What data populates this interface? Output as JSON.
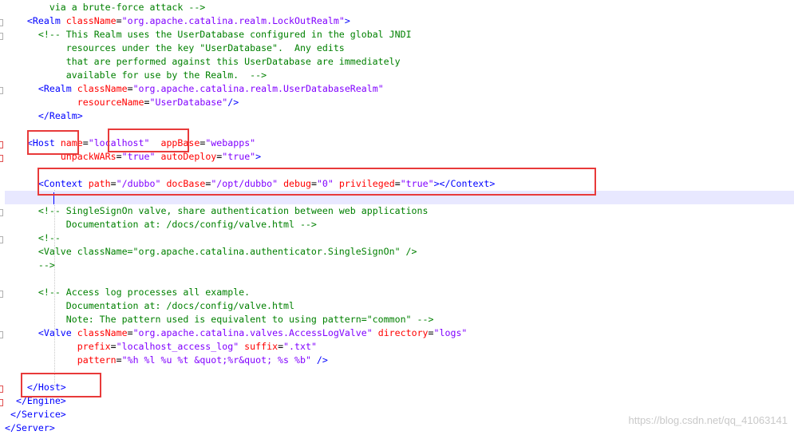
{
  "colors": {
    "tag": "#0000ff",
    "attr": "#ff0000",
    "value": "#8000ff",
    "comment": "#008000",
    "highlight_box": "#e83a3a",
    "current_line": "#e8e8ff"
  },
  "watermark": "https://blog.csdn.net/qq_41063141",
  "lines": [
    [
      [
        "cmt",
        "        via a brute-force attack -->"
      ]
    ],
    [
      [
        "txt",
        "    "
      ],
      [
        "tag",
        "<Realm "
      ],
      [
        "attr",
        "className"
      ],
      [
        "txt",
        "="
      ],
      [
        "val",
        "\"org.apache.catalina.realm.LockOutRealm\""
      ],
      [
        "tag",
        ">"
      ]
    ],
    [
      [
        "txt",
        "      "
      ],
      [
        "cmt",
        "<!-- This Realm uses the UserDatabase configured in the global JNDI"
      ]
    ],
    [
      [
        "cmt",
        "           resources under the key \"UserDatabase\".  Any edits"
      ]
    ],
    [
      [
        "cmt",
        "           that are performed against this UserDatabase are immediately"
      ]
    ],
    [
      [
        "cmt",
        "           available for use by the Realm.  -->"
      ]
    ],
    [
      [
        "txt",
        "      "
      ],
      [
        "tag",
        "<Realm "
      ],
      [
        "attr",
        "className"
      ],
      [
        "txt",
        "="
      ],
      [
        "val",
        "\"org.apache.catalina.realm.UserDatabaseRealm\""
      ]
    ],
    [
      [
        "txt",
        "             "
      ],
      [
        "attr",
        "resourceName"
      ],
      [
        "txt",
        "="
      ],
      [
        "val",
        "\"UserDatabase\""
      ],
      [
        "tag",
        "/>"
      ]
    ],
    [
      [
        "txt",
        "      "
      ],
      [
        "tag",
        "</Realm>"
      ]
    ],
    [
      [
        "txt",
        ""
      ]
    ],
    [
      [
        "txt",
        "    "
      ],
      [
        "tag",
        "<Host "
      ],
      [
        "attr",
        "name"
      ],
      [
        "txt",
        "="
      ],
      [
        "val",
        "\"localhost\""
      ],
      [
        "txt",
        "  "
      ],
      [
        "attr",
        "appBase"
      ],
      [
        "txt",
        "="
      ],
      [
        "val",
        "\"webapps\""
      ]
    ],
    [
      [
        "txt",
        "          "
      ],
      [
        "attr",
        "unpackWARs"
      ],
      [
        "txt",
        "="
      ],
      [
        "val",
        "\"true\""
      ],
      [
        "txt",
        " "
      ],
      [
        "attr",
        "autoDeploy"
      ],
      [
        "txt",
        "="
      ],
      [
        "val",
        "\"true\""
      ],
      [
        "tag",
        ">"
      ]
    ],
    [
      [
        "txt",
        ""
      ]
    ],
    [
      [
        "txt",
        "      "
      ],
      [
        "tag",
        "<Context "
      ],
      [
        "attr",
        "path"
      ],
      [
        "txt",
        "="
      ],
      [
        "val",
        "\"/dubbo\""
      ],
      [
        "txt",
        " "
      ],
      [
        "attr",
        "docBase"
      ],
      [
        "txt",
        "="
      ],
      [
        "val",
        "\"/opt/dubbo\""
      ],
      [
        "txt",
        " "
      ],
      [
        "attr",
        "debug"
      ],
      [
        "txt",
        "="
      ],
      [
        "val",
        "\"0\""
      ],
      [
        "txt",
        " "
      ],
      [
        "attr",
        "privileged"
      ],
      [
        "txt",
        "="
      ],
      [
        "val",
        "\"true\""
      ],
      [
        "tag",
        "></Context>"
      ]
    ],
    [
      [
        "txt",
        ""
      ]
    ],
    [
      [
        "txt",
        "      "
      ],
      [
        "cmt",
        "<!-- SingleSignOn valve, share authentication between web applications"
      ]
    ],
    [
      [
        "cmt",
        "           Documentation at: /docs/config/valve.html -->"
      ]
    ],
    [
      [
        "txt",
        "      "
      ],
      [
        "cmt",
        "<!--"
      ]
    ],
    [
      [
        "cmt",
        "      <Valve className=\"org.apache.catalina.authenticator.SingleSignOn\" />"
      ]
    ],
    [
      [
        "cmt",
        "      -->"
      ]
    ],
    [
      [
        "txt",
        ""
      ]
    ],
    [
      [
        "txt",
        "      "
      ],
      [
        "cmt",
        "<!-- Access log processes all example."
      ]
    ],
    [
      [
        "cmt",
        "           Documentation at: /docs/config/valve.html"
      ]
    ],
    [
      [
        "cmt",
        "           Note: The pattern used is equivalent to using pattern=\"common\" -->"
      ]
    ],
    [
      [
        "txt",
        "      "
      ],
      [
        "tag",
        "<Valve "
      ],
      [
        "attr",
        "className"
      ],
      [
        "txt",
        "="
      ],
      [
        "val",
        "\"org.apache.catalina.valves.AccessLogValve\""
      ],
      [
        "txt",
        " "
      ],
      [
        "attr",
        "directory"
      ],
      [
        "txt",
        "="
      ],
      [
        "val",
        "\"logs\""
      ]
    ],
    [
      [
        "txt",
        "             "
      ],
      [
        "attr",
        "prefix"
      ],
      [
        "txt",
        "="
      ],
      [
        "val",
        "\"localhost_access_log\""
      ],
      [
        "txt",
        " "
      ],
      [
        "attr",
        "suffix"
      ],
      [
        "txt",
        "="
      ],
      [
        "val",
        "\".txt\""
      ]
    ],
    [
      [
        "txt",
        "             "
      ],
      [
        "attr",
        "pattern"
      ],
      [
        "txt",
        "="
      ],
      [
        "val",
        "\"%h %l %u %t &quot;%r&quot; %s %b\""
      ],
      [
        "txt",
        " "
      ],
      [
        "tag",
        "/>"
      ]
    ],
    [
      [
        "txt",
        ""
      ]
    ],
    [
      [
        "txt",
        "    "
      ],
      [
        "tag",
        "</Host>"
      ]
    ],
    [
      [
        "txt",
        "  "
      ],
      [
        "tag",
        "</Engine>"
      ]
    ],
    [
      [
        "txt",
        " "
      ],
      [
        "tag",
        "</Service>"
      ]
    ],
    [
      [
        "tag",
        "</Server>"
      ]
    ]
  ]
}
